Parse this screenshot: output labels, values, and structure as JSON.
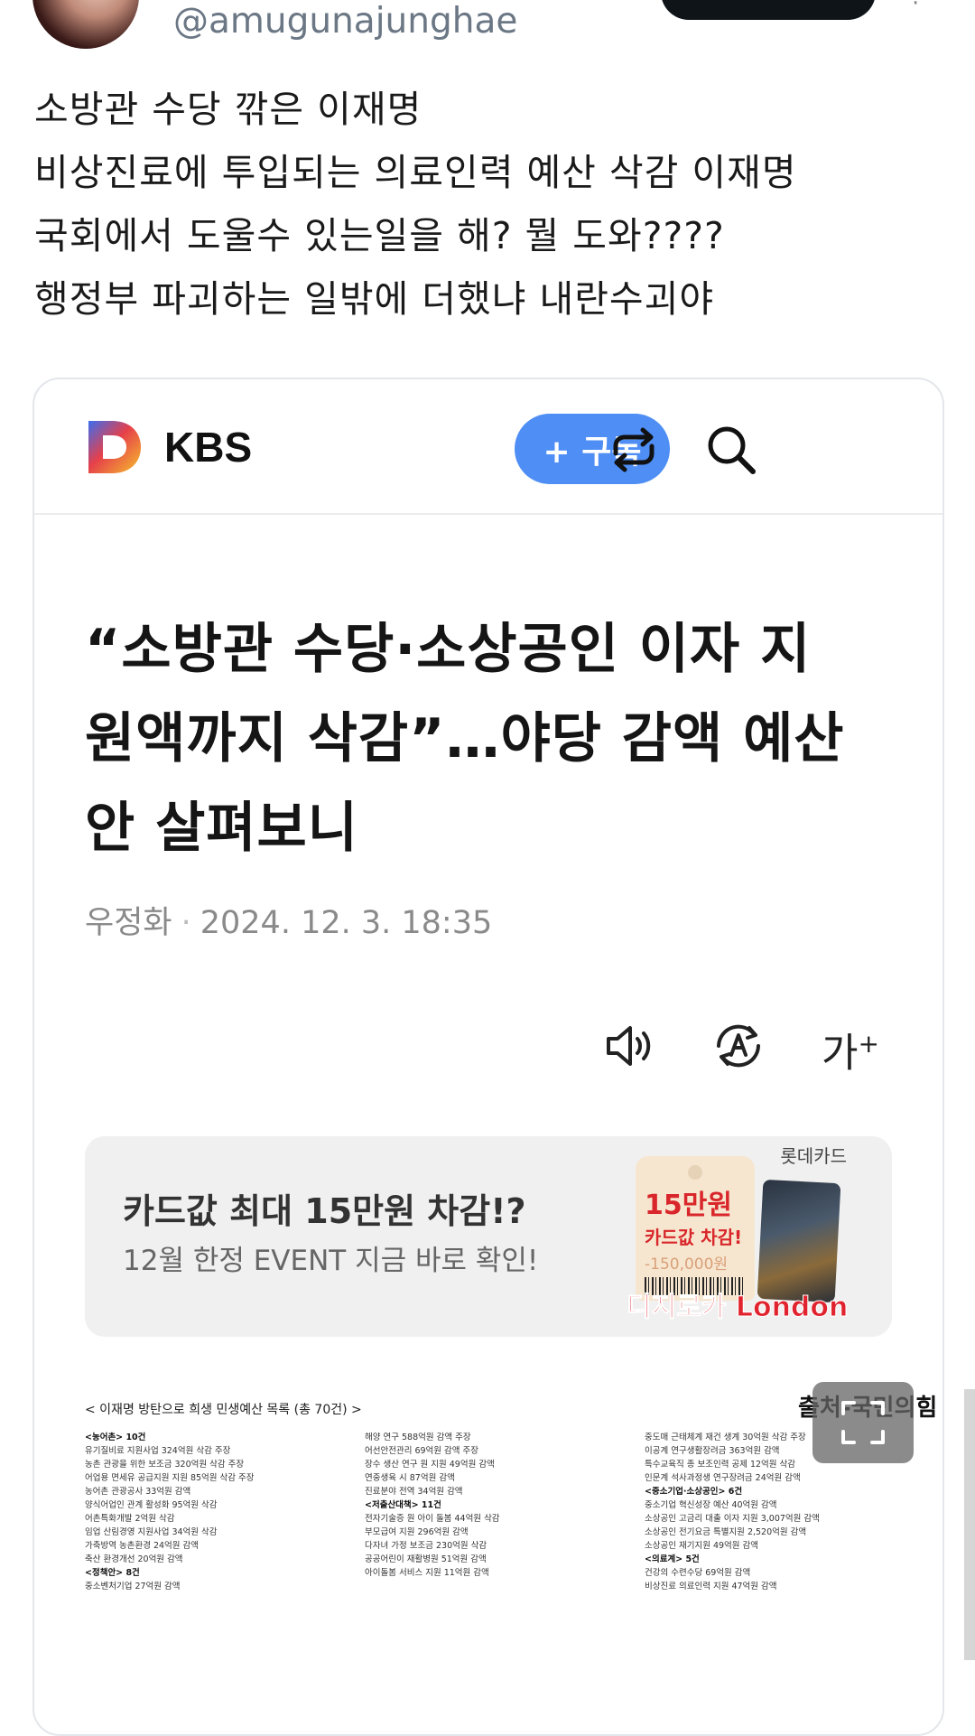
{
  "tweet": {
    "handle": "@amugunajunghae",
    "lines": [
      "소방관 수당 깎은 이재명",
      "비상진료에 투입되는 의료인력 예산 삭감 이재명",
      "국회에서 도울수 있는일을 해? 뭘 도와????",
      "행정부 파괴하는 일밖에 더했냐 내란수괴야"
    ]
  },
  "article": {
    "brand": "KBS",
    "subscribe_label": "+ 구독",
    "headline_lines": [
      "“소방관 수당·소상공인 이자 지",
      "원액까지 삭감”…야당 감액 예산",
      "안 살펴보니"
    ],
    "author": "우정화",
    "datetime": "2024. 12. 3. 18:35",
    "font_size_label": "가",
    "font_size_sup": "+"
  },
  "ad": {
    "title": "카드값 최대 15만원 차감!?",
    "subtitle": "12월 한정 EVENT 지금 바로 확인!",
    "sponsor": "롯데카드",
    "tag_big": "15만원",
    "tag_mid": "카드값 차감!",
    "tag_price": "-150,000원",
    "card_brand": "디지로카 London"
  },
  "document": {
    "title": "< 이재명 방탄으로 희생 민생예산 목록 (총 70건) >",
    "source": "출처-국민의힘",
    "columns": [
      [
        "<농어촌> 10건",
        "유기질비료 지원사업 324억원 삭감 주장",
        "농촌 관광을 위한 보조금 320억원 삭감 주장",
        "어업용 면세유 공급지원 지원 85억원 삭감 주장",
        "농어촌 관광공사 33억원 감액",
        "양식어업인 관계 활성화 95억원 삭감",
        "어촌특화개발 2억원 삭감",
        "임업 산림경영 지원사업 34억원 삭감",
        "가축방역 농촌환경 24억원 감액",
        "축산 환경개선 20억원 감액",
        "<정책안> 8건",
        "중소벤처기업 27억원 감액"
      ],
      [
        "해양 연구 588억원 감액 주장",
        "어선안전관리 69억원 감액 주장",
        "장수 생산 연구 원 지원 49억원 감액",
        "연중생육 시 87억원 감액",
        "진료분야 전역 34억원 감액",
        "",
        "<저출산대책> 11건",
        "전자기술증 원 아이 돌봄 44억원 삭감",
        "부모급여 지원 296억원 감액",
        "다자녀 가정 보조금 230억원 삭감",
        "공공어린이 재활병원 51억원 감액",
        "아이돌봄 서비스 지원 11억원 감액"
      ],
      [
        "중도매 근태체계 재건 생계 30억원 삭감 주장",
        "이공계 연구생활장려금 363억원 감액",
        "특수교육직 종 보조인력 공제 12억원 삭감",
        "인문계 석사과정생 연구장려금 24억원 감액",
        "",
        "<중소기업·소상공인> 6건",
        "중소기업 혁신성장 예산 40억원 감액",
        "소상공인 고금리 대출 이자 지원 3,007억원 감액",
        "소상공인 전기요금 특별지원 2,520억원 감액",
        "소상공인 재기지원 49억원 감액",
        "",
        "<의료계> 5건",
        "건강의 수련수당 69억원 감액",
        "비상진료 의료인력 지원 47억원 감액"
      ]
    ]
  }
}
